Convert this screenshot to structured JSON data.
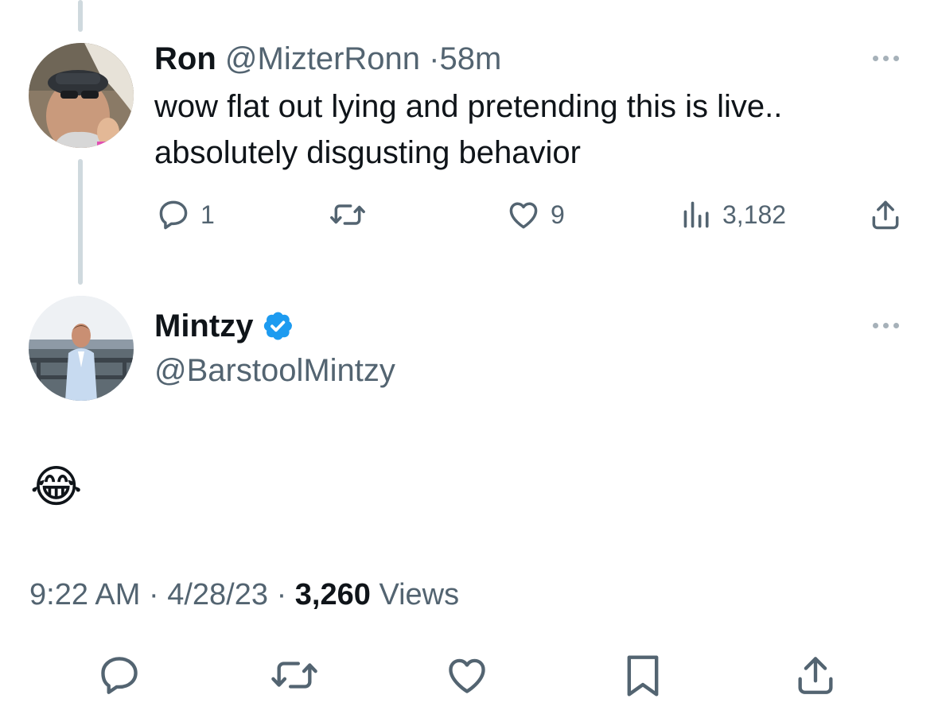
{
  "parent_tweet": {
    "display_name": "Ron",
    "handle": "@MizterRonn",
    "separator": "·",
    "time": "58m",
    "text_lines": [
      "wow flat out lying and pretending this is live..",
      "absolutely disgusting behavior"
    ],
    "reply_count": "1",
    "retweet_count": "",
    "like_count": "9",
    "view_count": "3,182"
  },
  "main_tweet": {
    "display_name": "Mintzy",
    "handle": "@BarstoolMintzy",
    "verified": true,
    "text": "😂",
    "time": "9:22 AM",
    "sep1": "·",
    "date": "4/28/23",
    "sep2": "·",
    "views_count": "3,260",
    "views_label": "Views"
  },
  "icons": {
    "reply": "reply-icon",
    "retweet": "retweet-icon",
    "like": "like-icon",
    "views": "views-icon",
    "share": "share-icon",
    "bookmark": "bookmark-icon",
    "more": "more-icon",
    "verified": "verified-badge-icon"
  },
  "colors": {
    "text": "#0f1419",
    "secondary": "#536471",
    "verified": "#1d9bf0",
    "thread_line": "#cfd9de"
  }
}
